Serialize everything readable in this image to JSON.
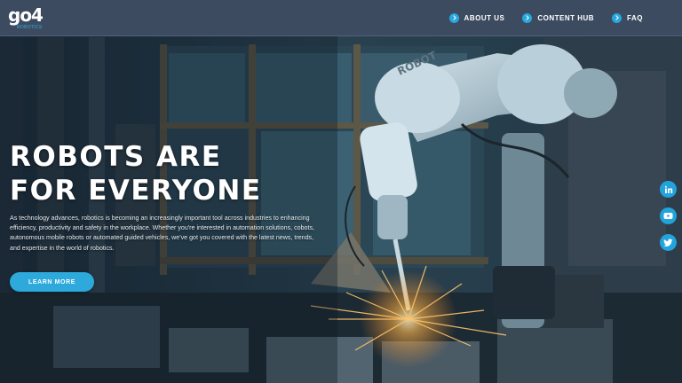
{
  "header": {
    "logo": {
      "main": "go4",
      "sub": "ROBOTICS"
    },
    "nav": [
      {
        "label": "ABOUT US",
        "icon": "chevron-right-icon"
      },
      {
        "label": "CONTENT HUB",
        "icon": "chevron-right-icon"
      },
      {
        "label": "FAQ",
        "icon": "chevron-right-icon"
      }
    ]
  },
  "hero": {
    "title_line1": "ROBOTS ARE",
    "title_line2": "FOR EVERYONE",
    "body": "As technology advances, robotics is becoming an increasingly important tool across industries to enhancing efficiency, productivity and safety in the workplace. Whether you're interested in automation solutions, cobots, autonomous mobile robots or automated guided vehicles, we've got you covered with the latest news, trends, and expertise in the world of robotics.",
    "cta_label": "LEARN MORE"
  },
  "social": [
    {
      "name": "linkedin",
      "icon": "linkedin-icon"
    },
    {
      "name": "youtube",
      "icon": "youtube-icon"
    },
    {
      "name": "twitter",
      "icon": "twitter-icon"
    }
  ],
  "colors": {
    "header_bg": "#3d4b61",
    "accent": "#2da9dc",
    "text": "#ffffff"
  }
}
